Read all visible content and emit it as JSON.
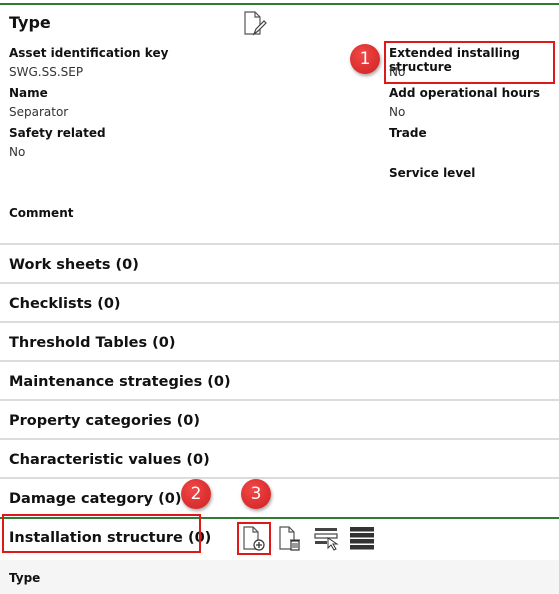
{
  "header": {
    "title": "Type"
  },
  "fields": {
    "left": [
      {
        "label": "Asset identification key",
        "value": "SWG.SS.SEP"
      },
      {
        "label": "Name",
        "value": "Separator"
      },
      {
        "label": "Safety related",
        "value": "No"
      }
    ],
    "right": [
      {
        "label": "Extended installing structure",
        "value": "No"
      },
      {
        "label": "Add operational hours",
        "value": "No"
      },
      {
        "label": "Trade",
        "value": ""
      },
      {
        "label": "Service level",
        "value": ""
      }
    ],
    "comment": {
      "label": "Comment",
      "value": ""
    }
  },
  "sections": [
    {
      "label": "Work sheets (0)"
    },
    {
      "label": "Checklists (0)"
    },
    {
      "label": "Threshold Tables (0)"
    },
    {
      "label": "Maintenance strategies (0)"
    },
    {
      "label": "Property categories (0)"
    },
    {
      "label": "Characteristic values (0)"
    },
    {
      "label": "Damage category (0)"
    },
    {
      "label": "Installation structure (0)"
    }
  ],
  "toolbar": {
    "icons": [
      "add-document-icon",
      "delete-document-icon",
      "select-row-icon",
      "list-view-icon"
    ]
  },
  "table": {
    "columns": [
      "Type"
    ]
  },
  "annotations": {
    "badge1": "1",
    "badge2": "2",
    "badge3": "3",
    "color": "#e01818"
  }
}
